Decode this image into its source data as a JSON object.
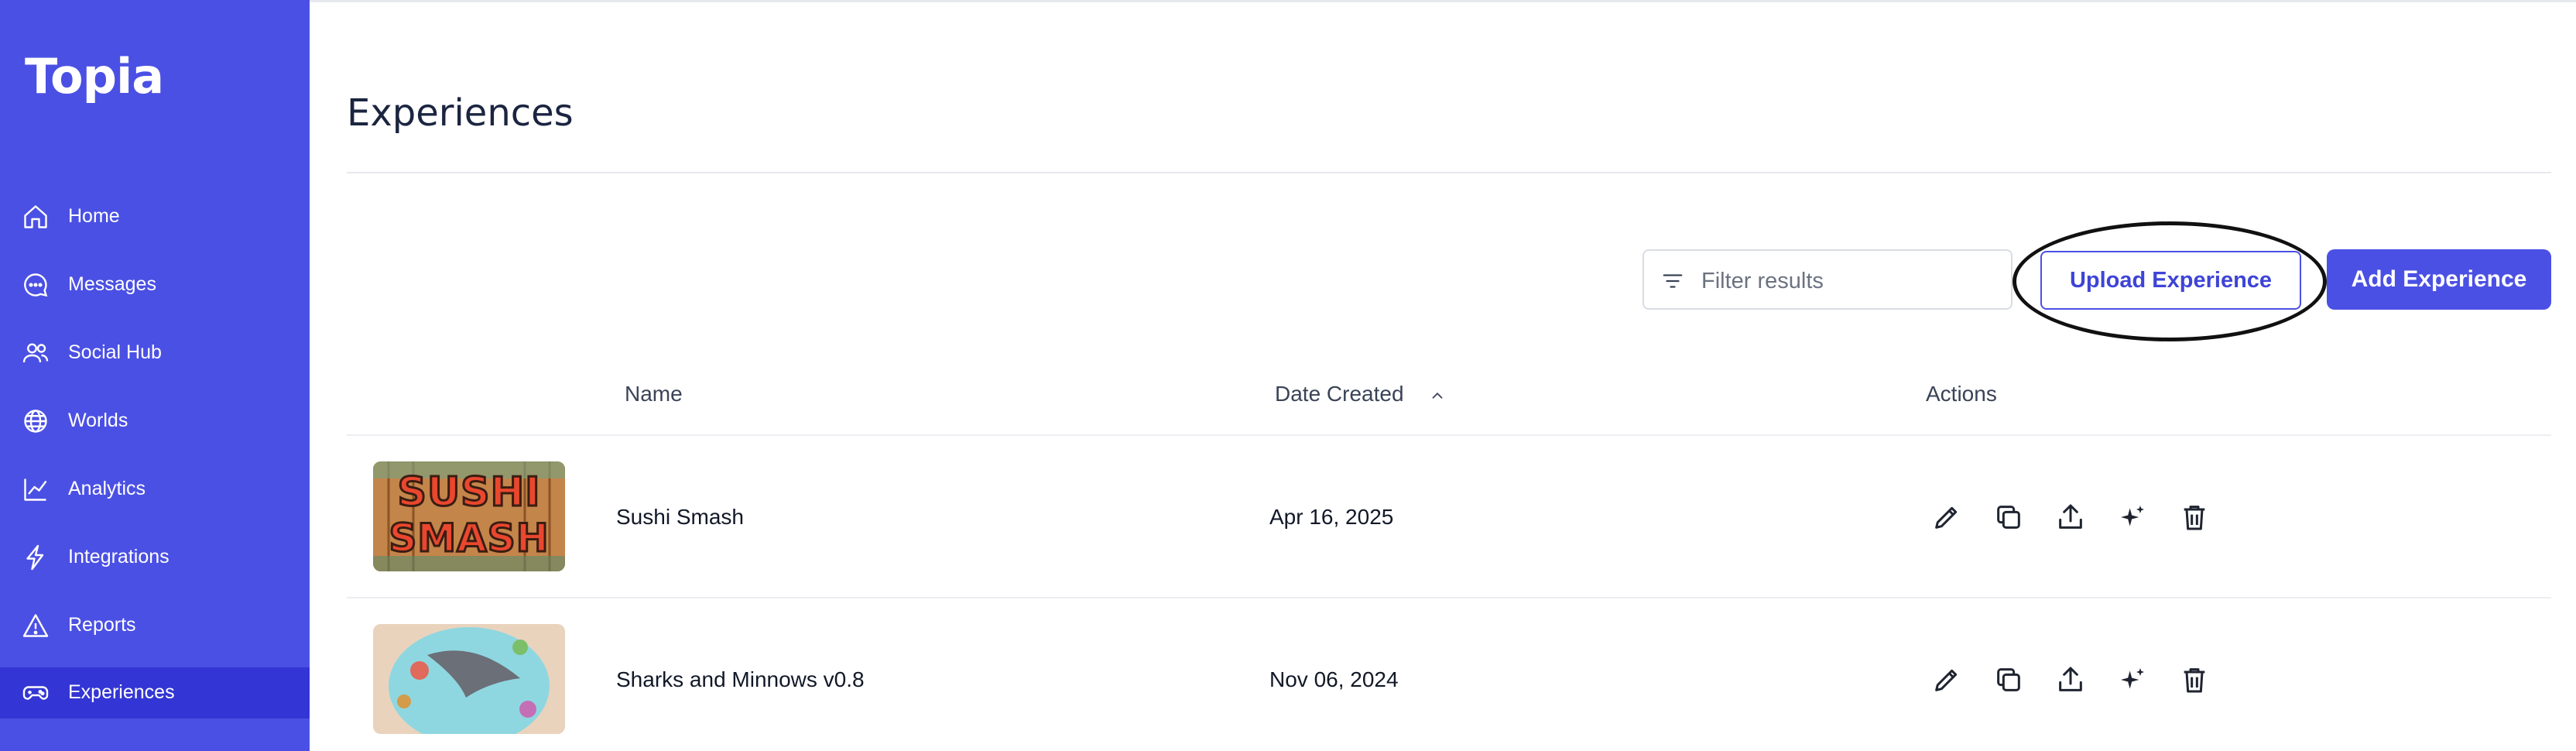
{
  "app": {
    "logo": "Topia"
  },
  "sidebar": {
    "items": [
      {
        "label": "Home",
        "icon": "home-icon"
      },
      {
        "label": "Messages",
        "icon": "chat-icon"
      },
      {
        "label": "Social Hub",
        "icon": "users-icon"
      },
      {
        "label": "Worlds",
        "icon": "globe-icon"
      },
      {
        "label": "Analytics",
        "icon": "chart-icon"
      },
      {
        "label": "Integrations",
        "icon": "bolt-icon"
      },
      {
        "label": "Reports",
        "icon": "warning-icon"
      },
      {
        "label": "Experiences",
        "icon": "gamepad-icon",
        "active": true
      }
    ]
  },
  "page": {
    "title": "Experiences",
    "filter_placeholder": "Filter results",
    "upload_label": "Upload Experience",
    "add_label": "Add Experience"
  },
  "table": {
    "columns": [
      "Name",
      "Date Created",
      "Actions"
    ],
    "sort": {
      "column": "Date Created",
      "direction": "ascending"
    },
    "actions": [
      "edit-icon",
      "duplicate-icon",
      "share-icon",
      "sparkles-icon",
      "trash-icon"
    ],
    "rows": [
      {
        "name": "Sushi Smash",
        "date": "Apr 16, 2025",
        "thumb_text_1": "SUSHI",
        "thumb_text_2": "SMASH"
      },
      {
        "name": "Sharks and Minnows v0.8",
        "date": "Nov 06, 2024"
      }
    ]
  },
  "colors": {
    "accent": "#4b50e4",
    "sidebar_active": "#3336d4"
  }
}
